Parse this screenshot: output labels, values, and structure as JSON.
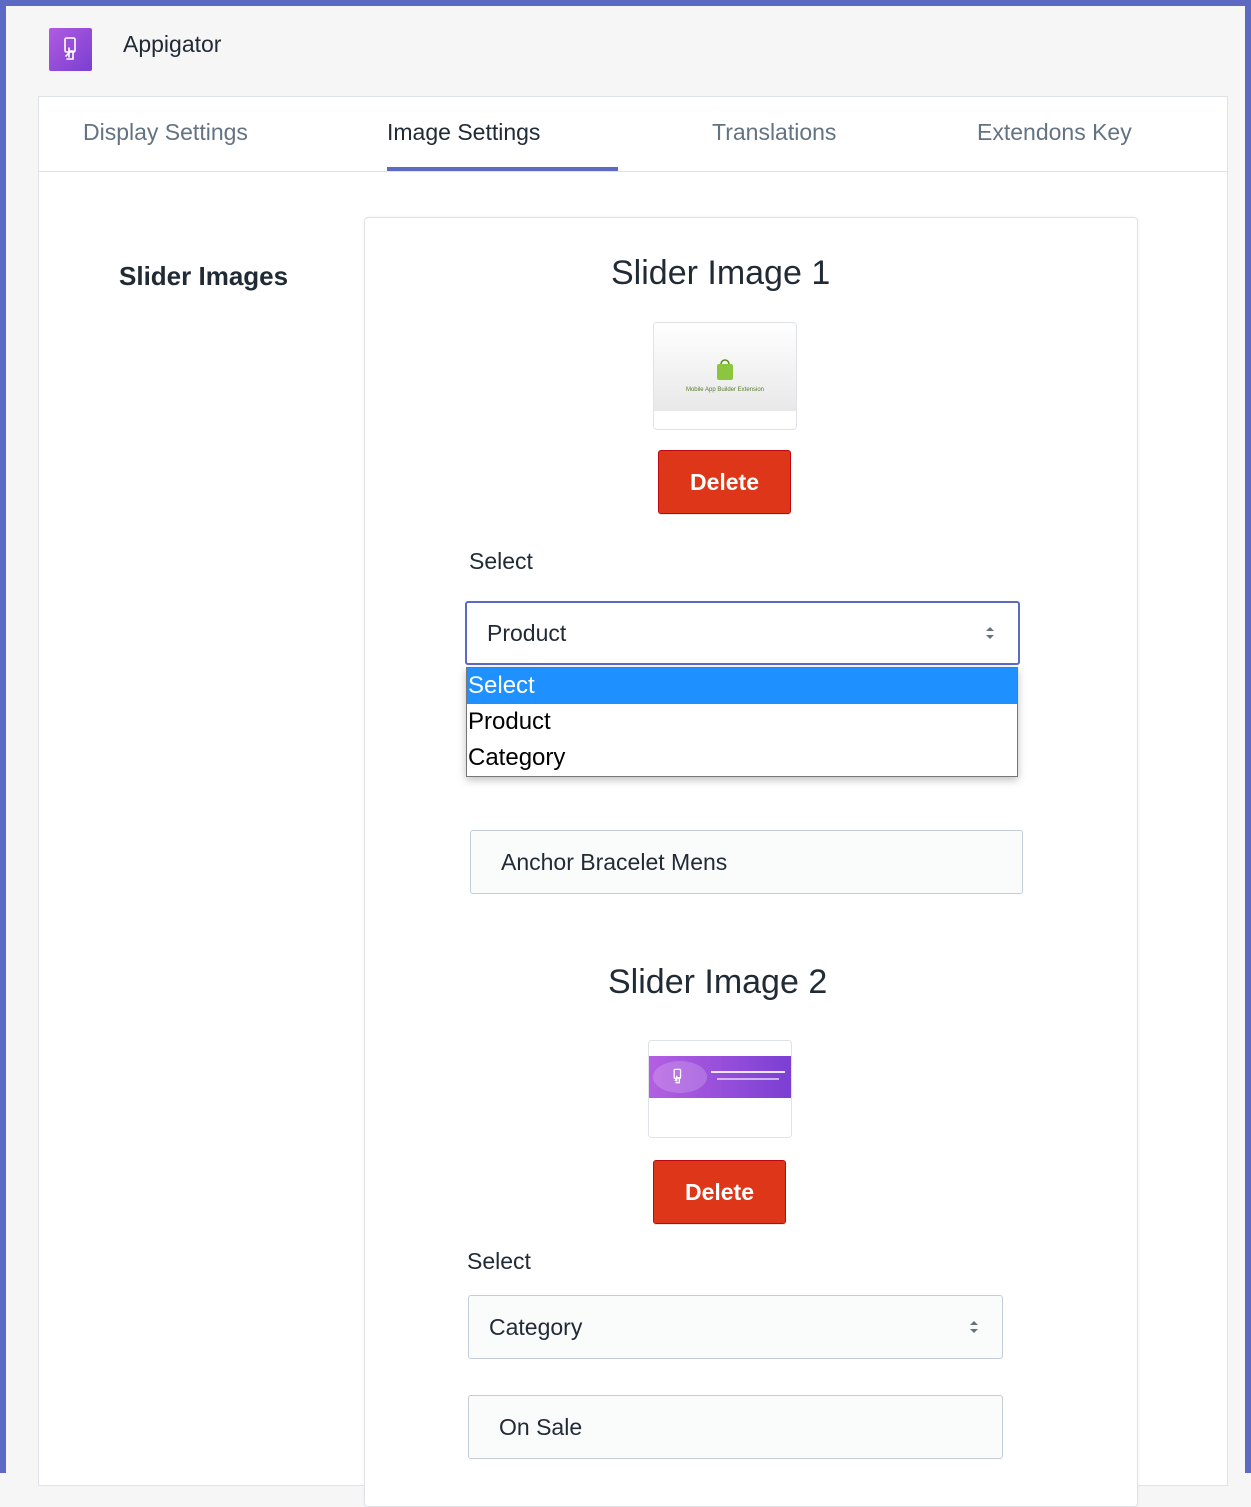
{
  "app": {
    "name": "Appigator",
    "logo_icon": "hand-tap-icon",
    "accent_color": "#5c6ac4"
  },
  "tabs": [
    {
      "label": "Display Settings",
      "active": false
    },
    {
      "label": "Image Settings",
      "active": true
    },
    {
      "label": "Translations",
      "active": false
    },
    {
      "label": "Extendons Key",
      "active": false
    }
  ],
  "section": {
    "label": "Slider Images"
  },
  "slider1": {
    "title": "Slider Image 1",
    "thumb_caption": "Mobile App Builder Extension",
    "delete_label": "Delete",
    "select_label": "Select",
    "select_value": "Product",
    "dropdown_options": [
      "Select",
      "Product",
      "Category"
    ],
    "highlighted_option": "Select",
    "text_value": "Anchor Bracelet Mens"
  },
  "slider2": {
    "title": "Slider Image 2",
    "delete_label": "Delete",
    "select_label": "Select",
    "select_value": "Category",
    "text_value": "On Sale"
  },
  "colors": {
    "delete": "#de3618",
    "highlight": "#1e90ff",
    "active_tab": "#5c6ac4"
  }
}
